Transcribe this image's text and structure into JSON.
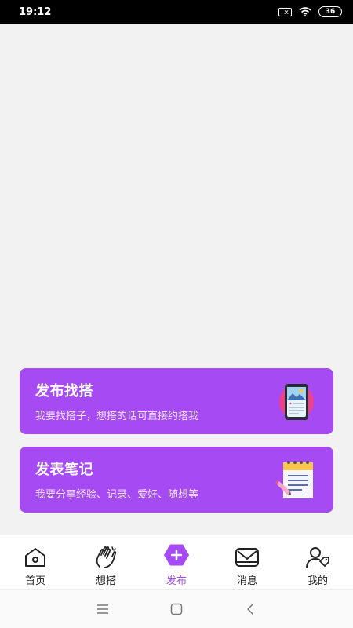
{
  "status": {
    "time": "19:12",
    "battery": "36"
  },
  "cards": [
    {
      "title": "发布找搭",
      "desc": "我要找搭子，想搭的话可直接约搭我"
    },
    {
      "title": "发表笔记",
      "desc": "我要分享经验、记录、爱好、随想等"
    }
  ],
  "tabs": [
    {
      "label": "首页",
      "icon": "home-icon"
    },
    {
      "label": "想搭",
      "icon": "clap-hands-icon"
    },
    {
      "label": "发布",
      "icon": "plus-hex-icon"
    },
    {
      "label": "消息",
      "icon": "mail-icon"
    },
    {
      "label": "我的",
      "icon": "user-icon"
    }
  ],
  "colors": {
    "accent": "#a64bf4",
    "background": "#f2f2f2"
  }
}
